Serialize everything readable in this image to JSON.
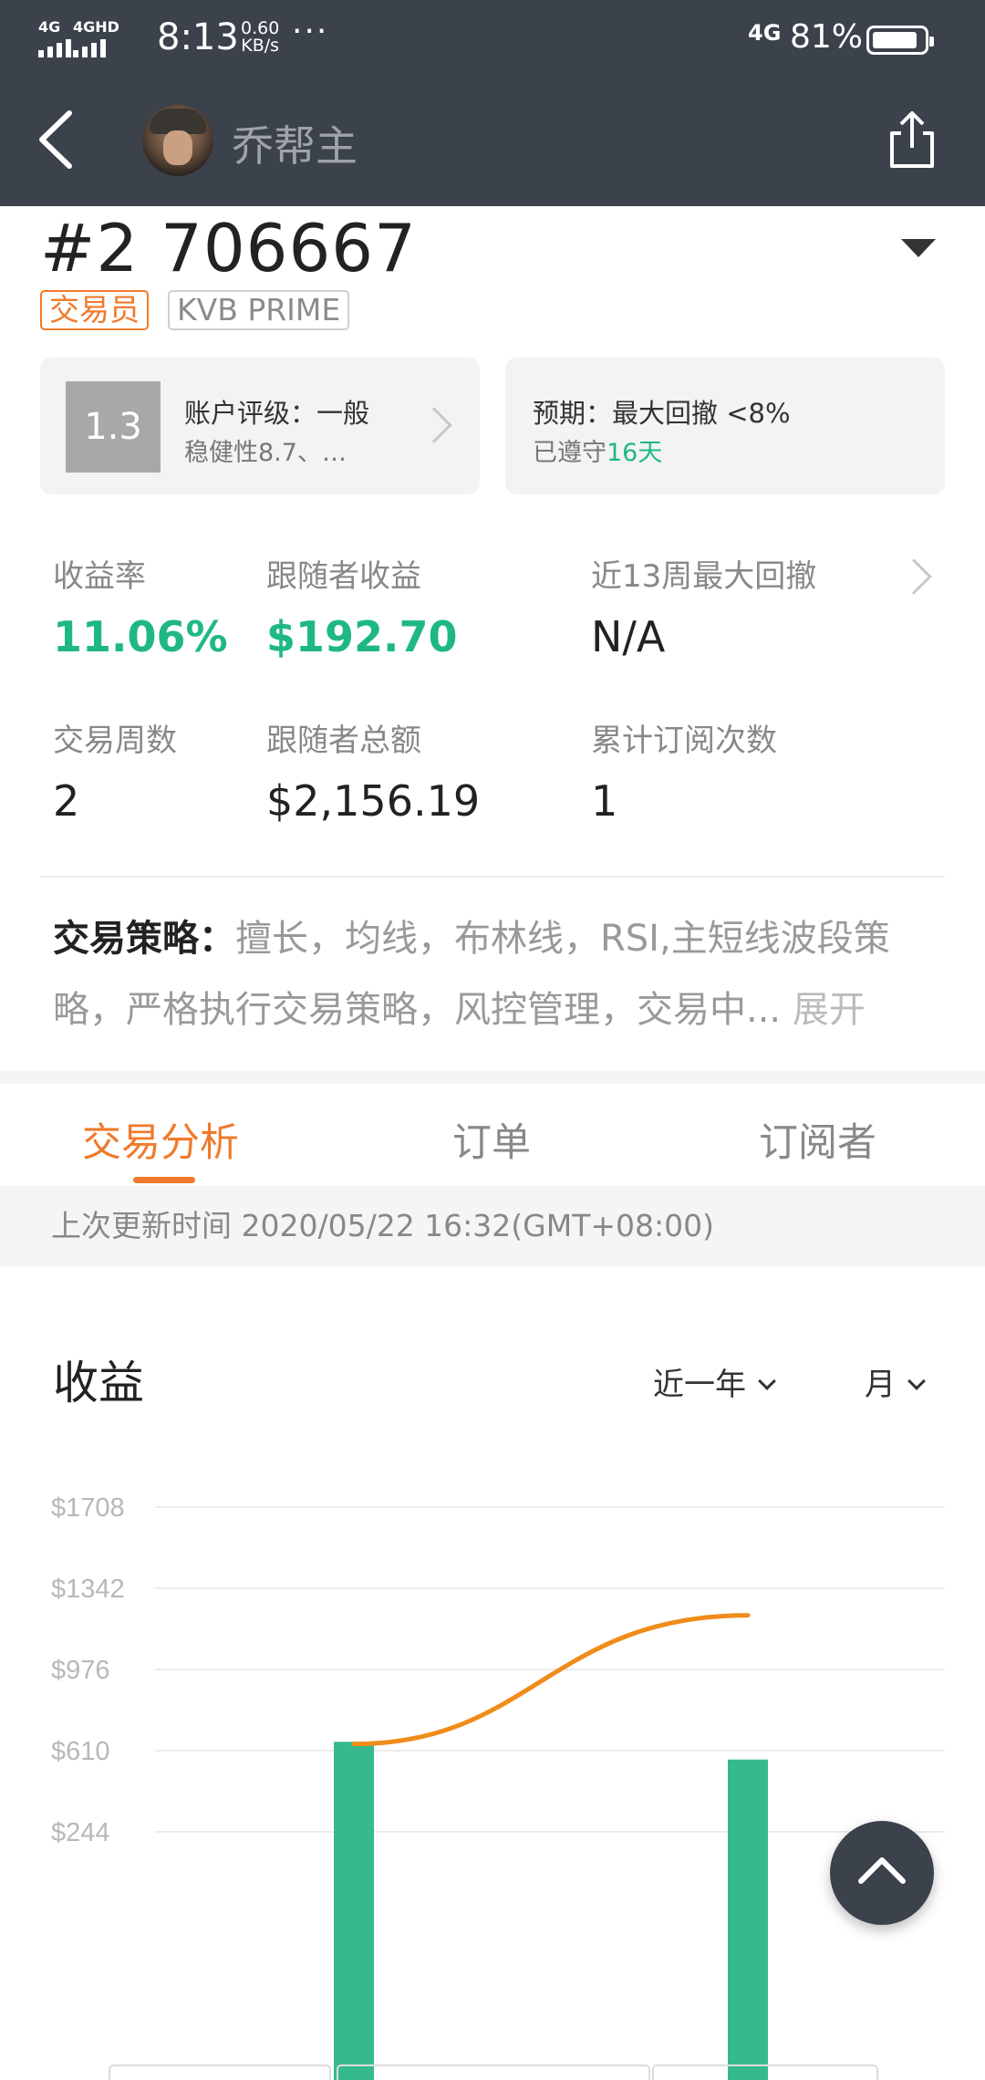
{
  "status_bar": {
    "signal_1": "4G",
    "signal_2": "4GHD",
    "time": "8:13",
    "speed_value": "0.60",
    "speed_unit": "KB/s",
    "more": "···",
    "network": "4G",
    "battery": "81%"
  },
  "header": {
    "name": "乔帮主",
    "icons": {
      "back": "back-arrow-icon",
      "share": "share-icon",
      "avatar": "avatar"
    }
  },
  "account": {
    "title": "#2 706667",
    "tag_trader": "交易员",
    "tag_brand": "KVB PRIME"
  },
  "rating_card": {
    "score": "1.3",
    "line1": "账户评级：一般",
    "line2": "稳健性8.7、…"
  },
  "expect_card": {
    "line1": "预期：最大回撤 <8%",
    "line2_prefix": "已遵守",
    "line2_days": "16天"
  },
  "stats": [
    {
      "label": "收益率",
      "value": "11.06%"
    },
    {
      "label": "跟随者收益",
      "value": "$192.70"
    },
    {
      "label": "近13周最大回撤",
      "value": "N/A"
    },
    {
      "label": "交易周数",
      "value": "2"
    },
    {
      "label": "跟随者总额",
      "value": "$2,156.19"
    },
    {
      "label": "累计订阅次数",
      "value": "1"
    }
  ],
  "strategy": {
    "label": "交易策略：",
    "text": "擅长，均线，布林线，RSI,主短线波段策略，严格执行交易策略，风控管理，交易中...",
    "expand": "展开"
  },
  "tabs": [
    {
      "label": "交易分析"
    },
    {
      "label": "订单"
    },
    {
      "label": "订阅者"
    }
  ],
  "update_text": "上次更新时间 2020/05/22 16:32(GMT+08:00)",
  "section": {
    "title": "收益",
    "range": "近一年",
    "period": "月"
  },
  "colors": {
    "accent": "#f07a2c",
    "green": "#1fb884",
    "header_bg": "#3c424c",
    "bar": "#36b98f",
    "line": "#f08c1a"
  },
  "chart_data": {
    "type": "bar",
    "y_ticks": [
      "$1708",
      "$1342",
      "$976",
      "$610",
      "$244"
    ],
    "ylim": [
      -122,
      1708
    ],
    "bars": [
      {
        "value": 650
      },
      {
        "value": 570
      }
    ],
    "line": [
      {
        "value": 640
      },
      {
        "value": 1220
      }
    ]
  }
}
